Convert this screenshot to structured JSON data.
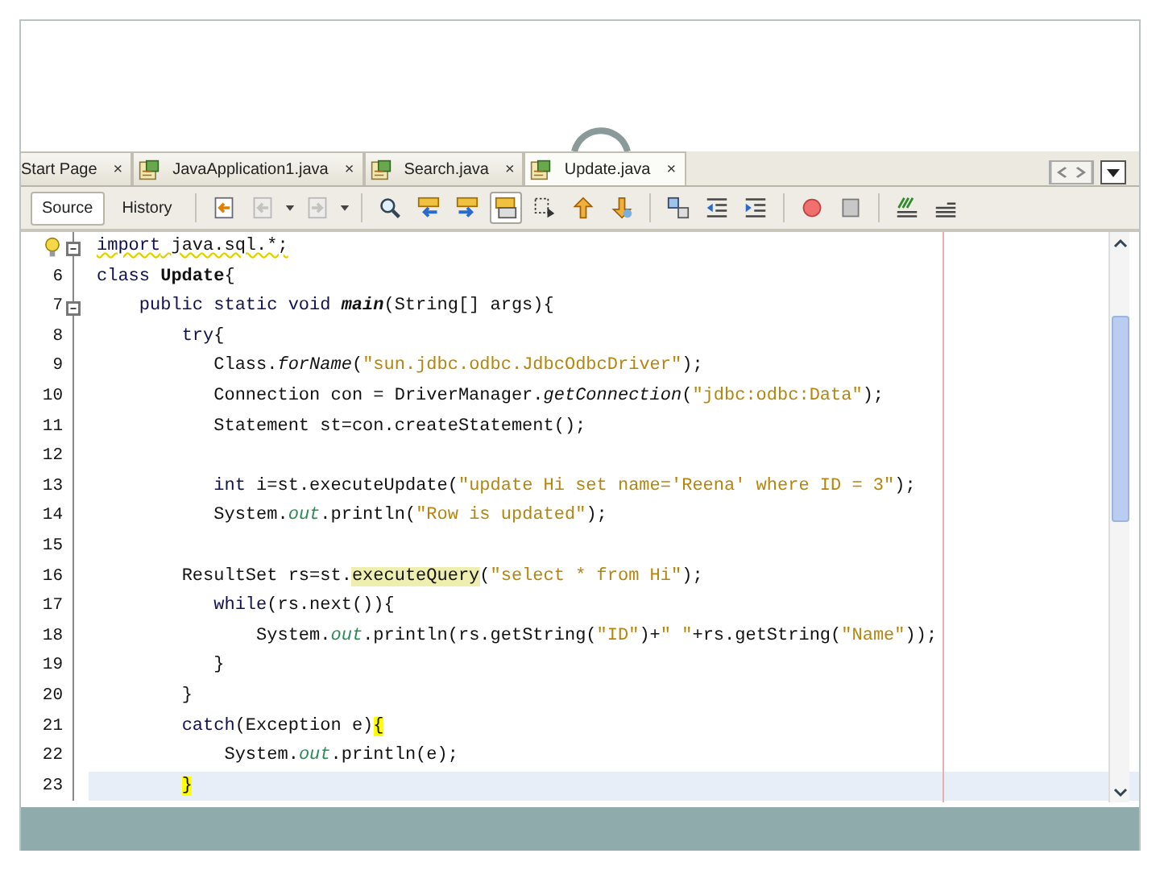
{
  "tabs": [
    {
      "label": "Start Page",
      "selected": false,
      "cut": true
    },
    {
      "label": "JavaApplication1.java",
      "selected": false
    },
    {
      "label": "Search.java",
      "selected": false
    },
    {
      "label": "Update.java",
      "selected": true
    }
  ],
  "tab_close": "×",
  "view_switch": [
    {
      "label": "Source",
      "selected": true
    },
    {
      "label": "History",
      "selected": false
    }
  ],
  "toolbar": [
    {
      "kind": "last-edit",
      "disabled": false
    },
    {
      "kind": "back",
      "disabled": true,
      "menu": true
    },
    {
      "kind": "forward",
      "disabled": true,
      "menu": true
    },
    {
      "kind": "find",
      "disabled": false
    },
    {
      "kind": "find-previous",
      "disabled": false
    },
    {
      "kind": "find-next",
      "disabled": false
    },
    {
      "kind": "highlight",
      "disabled": false,
      "pressed": true
    },
    {
      "kind": "rect-select",
      "disabled": false
    },
    {
      "kind": "shift-up",
      "disabled": false
    },
    {
      "kind": "shift-down",
      "disabled": false
    },
    {
      "kind": "shapes",
      "disabled": false
    },
    {
      "kind": "outdent",
      "disabled": false
    },
    {
      "kind": "indent",
      "disabled": false
    },
    {
      "kind": "record",
      "disabled": false
    },
    {
      "kind": "stop",
      "disabled": false
    },
    {
      "kind": "comment",
      "disabled": false
    },
    {
      "kind": "uncomment",
      "disabled": false
    }
  ],
  "editor": {
    "lines": [
      {
        "hint": true,
        "fold": true,
        "warning": true,
        "segments": [
          {
            "text": "import",
            "kind": "keyword"
          },
          {
            "text": " java.sql.*;",
            "kind": "plain"
          }
        ]
      },
      {
        "number": "6",
        "segments": [
          {
            "text": "class ",
            "kind": "keyword"
          },
          {
            "text": "Update",
            "kind": "declaration"
          },
          {
            "text": "{",
            "kind": "plain"
          }
        ]
      },
      {
        "number": "7",
        "fold": true,
        "segments": [
          {
            "text": "    public static void ",
            "kind": "keyword"
          },
          {
            "text": "main",
            "kind": "method-declaration"
          },
          {
            "text": "(String[] args){",
            "kind": "plain"
          }
        ]
      },
      {
        "number": "8",
        "segments": [
          {
            "text": "        try",
            "kind": "keyword"
          },
          {
            "text": "{",
            "kind": "plain"
          }
        ]
      },
      {
        "number": "9",
        "segments": [
          {
            "text": "           Class.",
            "kind": "plain"
          },
          {
            "text": "forName",
            "kind": "static"
          },
          {
            "text": "(",
            "kind": "plain"
          },
          {
            "text": "\"sun.jdbc.odbc.JdbcOdbcDriver\"",
            "kind": "string"
          },
          {
            "text": ");",
            "kind": "plain"
          }
        ]
      },
      {
        "number": "10",
        "segments": [
          {
            "text": "           Connection con = DriverManager.",
            "kind": "plain"
          },
          {
            "text": "getConnection",
            "kind": "static"
          },
          {
            "text": "(",
            "kind": "plain"
          },
          {
            "text": "\"jdbc:odbc:Data\"",
            "kind": "string"
          },
          {
            "text": ");",
            "kind": "plain"
          }
        ]
      },
      {
        "number": "11",
        "segments": [
          {
            "text": "           Statement st=con.createStatement();",
            "kind": "plain"
          }
        ]
      },
      {
        "number": "12"
      },
      {
        "number": "13",
        "segments": [
          {
            "text": "           int",
            "kind": "keyword"
          },
          {
            "text": " i=st.executeUpdate(",
            "kind": "plain"
          },
          {
            "text": "\"update Hi set name='Reena' where ID = 3\"",
            "kind": "string"
          },
          {
            "text": ");",
            "kind": "plain"
          }
        ]
      },
      {
        "number": "14",
        "segments": [
          {
            "text": "           System.",
            "kind": "plain"
          },
          {
            "text": "out",
            "kind": "field"
          },
          {
            "text": ".println(",
            "kind": "plain"
          },
          {
            "text": "\"Row is updated\"",
            "kind": "string"
          },
          {
            "text": ");",
            "kind": "plain"
          }
        ]
      },
      {
        "number": "15"
      },
      {
        "number": "16",
        "segments": [
          {
            "text": "        ResultSet rs=st.",
            "kind": "plain"
          },
          {
            "text": "executeQuery",
            "kind": "match"
          },
          {
            "text": "(",
            "kind": "plain"
          },
          {
            "text": "\"select * from Hi\"",
            "kind": "string"
          },
          {
            "text": ");",
            "kind": "plain"
          }
        ]
      },
      {
        "number": "17",
        "segments": [
          {
            "text": "           while",
            "kind": "keyword"
          },
          {
            "text": "(rs.next()){",
            "kind": "plain"
          }
        ]
      },
      {
        "number": "18",
        "segments": [
          {
            "text": "               System.",
            "kind": "plain"
          },
          {
            "text": "out",
            "kind": "field"
          },
          {
            "text": ".println(rs.getString(",
            "kind": "plain"
          },
          {
            "text": "\"ID\"",
            "kind": "string"
          },
          {
            "text": ")+",
            "kind": "plain"
          },
          {
            "text": "\" \"",
            "kind": "string"
          },
          {
            "text": "+rs.getString(",
            "kind": "plain"
          },
          {
            "text": "\"Name\"",
            "kind": "string"
          },
          {
            "text": "));",
            "kind": "plain"
          }
        ]
      },
      {
        "number": "19",
        "segments": [
          {
            "text": "           }",
            "kind": "plain"
          }
        ]
      },
      {
        "number": "20",
        "segments": [
          {
            "text": "        }",
            "kind": "plain"
          }
        ]
      },
      {
        "number": "21",
        "segments": [
          {
            "text": "        catch",
            "kind": "keyword"
          },
          {
            "text": "(Exception e)",
            "kind": "plain"
          },
          {
            "text": "{",
            "kind": "brace"
          }
        ]
      },
      {
        "number": "22",
        "segments": [
          {
            "text": "            System.",
            "kind": "plain"
          },
          {
            "text": "out",
            "kind": "field"
          },
          {
            "text": ".println(e);",
            "kind": "plain"
          }
        ]
      },
      {
        "number": "23",
        "current": true,
        "segments": [
          {
            "text": "        }",
            "kind": "brace"
          }
        ]
      }
    ]
  }
}
